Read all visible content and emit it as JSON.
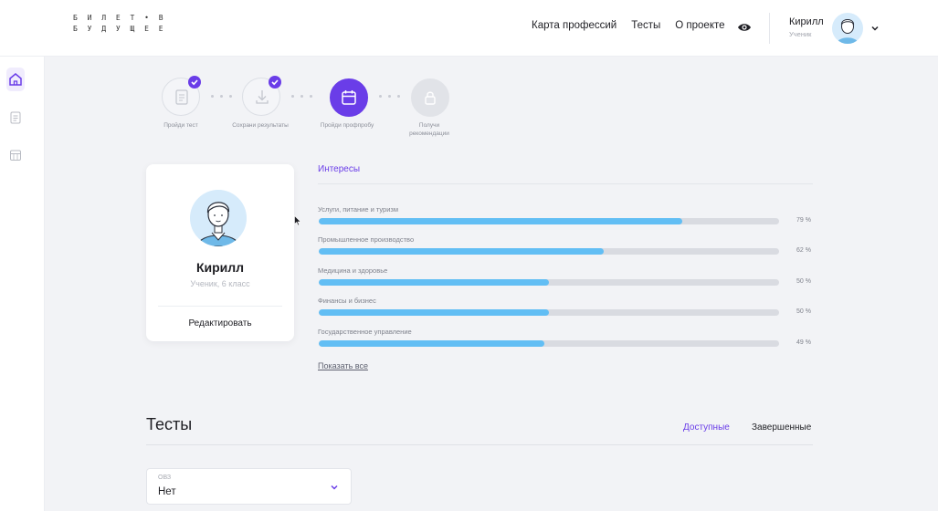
{
  "header": {
    "logo_line1": "Б И Л Е Т • В",
    "logo_line2": "Б У Д У Щ Е Е",
    "nav": {
      "career_map": "Карта профессий",
      "tests": "Тесты",
      "about": "О проекте"
    },
    "user_name": "Кирилл",
    "user_role": "Ученик"
  },
  "stepper": {
    "steps": [
      {
        "label": "Пройди тест",
        "state": "done"
      },
      {
        "label": "Сохрани результаты",
        "state": "done"
      },
      {
        "label": "Пройди профпробу",
        "state": "active"
      },
      {
        "label": "Получи рекомендации",
        "state": "locked"
      }
    ]
  },
  "profile": {
    "name": "Кирилл",
    "subtitle": "Ученик, 6 класс",
    "edit_label": "Редактировать"
  },
  "interests": {
    "tab_label": "Интересы",
    "items": [
      {
        "label": "Услуги, питание и туризм",
        "value": 79,
        "value_text": "79 %"
      },
      {
        "label": "Промышленное производство",
        "value": 62,
        "value_text": "62 %"
      },
      {
        "label": "Медицина и здоровье",
        "value": 50,
        "value_text": "50 %"
      },
      {
        "label": "Финансы и бизнес",
        "value": 50,
        "value_text": "50 %"
      },
      {
        "label": "Государственное управление",
        "value": 49,
        "value_text": "49 %"
      }
    ],
    "show_all": "Показать все"
  },
  "tests": {
    "title": "Тесты",
    "tab_available": "Доступные",
    "tab_completed": "Завершенные",
    "filter": {
      "label": "ОВЗ",
      "value": "Нет"
    }
  },
  "colors": {
    "accent": "#6a3de8",
    "bar_fill": "#62bef4",
    "bar_track": "#d9dbe1"
  }
}
